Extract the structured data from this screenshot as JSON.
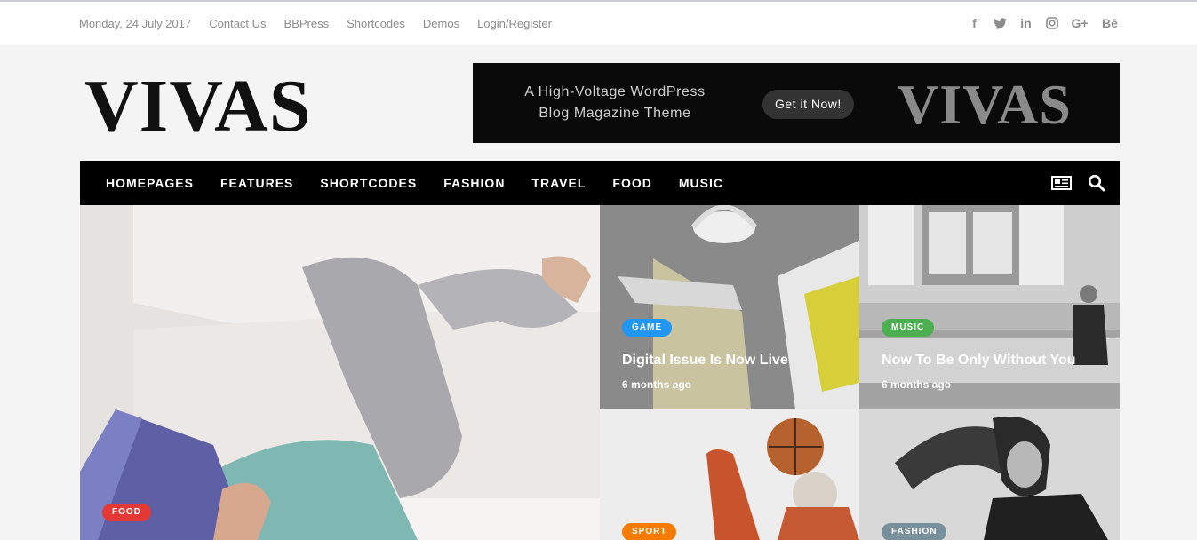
{
  "topbar": {
    "date": "Monday, 24 July 2017",
    "links": [
      "Contact Us",
      "BBPress",
      "Shortcodes",
      "Demos",
      "Login/Register"
    ],
    "social_icons": [
      "facebook-icon",
      "twitter-icon",
      "linkedin-icon",
      "instagram-icon",
      "google-plus-icon",
      "behance-icon"
    ],
    "social_glyphs": [
      "f",
      "t",
      "in",
      "◎",
      "G+",
      "Bē"
    ]
  },
  "logo": {
    "text": "VIVAS"
  },
  "banner": {
    "tagline_line1": "A High-Voltage WordPress",
    "tagline_line2": "Blog Magazine Theme",
    "cta": "Get it Now!",
    "logo": "VIVAS"
  },
  "nav": {
    "items": [
      "HOMEPAGES",
      "FEATURES",
      "SHORTCODES",
      "FASHION",
      "TRAVEL",
      "FOOD",
      "MUSIC"
    ]
  },
  "posts": {
    "hero": {
      "category": "FOOD",
      "category_color": "#e53935"
    },
    "game": {
      "category": "GAME",
      "category_color": "#2196f3",
      "title": "Digital Issue Is Now Live",
      "ago": "6 months ago"
    },
    "music": {
      "category": "MUSIC",
      "category_color": "#4caf50",
      "title": "Now To Be Only Without You",
      "ago": "6 months ago"
    },
    "sport": {
      "category": "SPORT",
      "category_color": "#f57c00"
    },
    "fashion": {
      "category": "FASHION",
      "category_color": "#78909c"
    }
  }
}
